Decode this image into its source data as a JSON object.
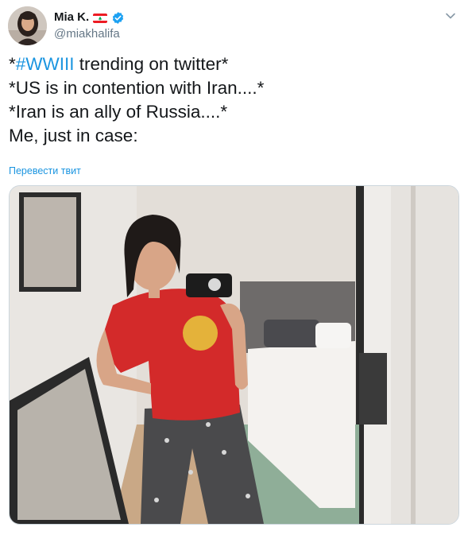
{
  "author": {
    "display_name": "Mia K.",
    "handle": "@miakhalifa",
    "verified": true,
    "flag_colors": [
      "#ed1c24",
      "#ffffff",
      "#00a651"
    ]
  },
  "tweet": {
    "prefix": "*",
    "hashtag": "#WWIII",
    "line1_rest": " trending on twitter*",
    "line2": "*US is in contention with Iran....*",
    "line3": "*Iran is an ally of Russia....*",
    "line4": "Me, just in case:"
  },
  "translate_label": "Перевести твит",
  "icons": {
    "menu": "chevron-down-icon",
    "verified": "verified-badge-icon"
  },
  "colors": {
    "link": "#1b95e0",
    "text": "#14171a",
    "secondary": "#657786",
    "border": "#ccd6dd"
  }
}
